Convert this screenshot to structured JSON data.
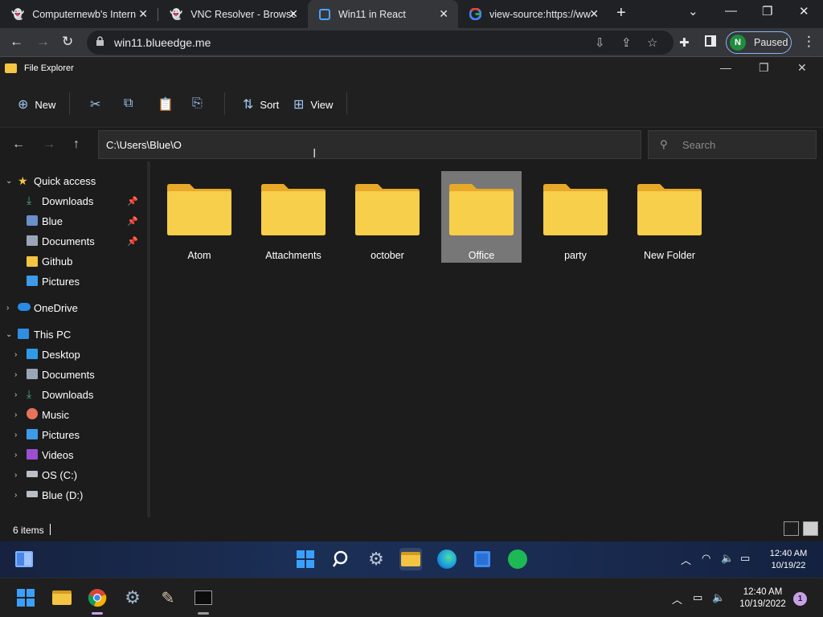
{
  "browser": {
    "tabs": [
      {
        "title": "Computernewb's Intern",
        "close": "✕"
      },
      {
        "title": "VNC Resolver - Browse",
        "close": "✕"
      },
      {
        "title": "Win11 in React",
        "close": "✕"
      },
      {
        "title": "view-source:https://ww",
        "close": "✕"
      }
    ],
    "active_tab": 2,
    "new_tab": "+",
    "url": "win11.blueedge.me",
    "profile_initial": "N",
    "profile_label": "Paused"
  },
  "explorer": {
    "title": "File Explorer",
    "commands": {
      "new_label": "New",
      "sort_label": "Sort",
      "view_label": "View"
    },
    "address": "C:\\Users\\Blue\\O",
    "search_placeholder": "Search",
    "sidebar": {
      "quick_access": "Quick access",
      "quick_items": [
        {
          "label": "Downloads",
          "pinned": true
        },
        {
          "label": "Blue",
          "pinned": true
        },
        {
          "label": "Documents",
          "pinned": true
        },
        {
          "label": "Github",
          "pinned": false
        },
        {
          "label": "Pictures",
          "pinned": false
        }
      ],
      "onedrive": "OneDrive",
      "this_pc": "This PC",
      "pc_items": [
        {
          "label": "Desktop"
        },
        {
          "label": "Documents"
        },
        {
          "label": "Downloads"
        },
        {
          "label": "Music"
        },
        {
          "label": "Pictures"
        },
        {
          "label": "Videos"
        },
        {
          "label": "OS (C:)"
        },
        {
          "label": "Blue (D:)"
        }
      ]
    },
    "folders": [
      {
        "name": "Atom",
        "selected": false
      },
      {
        "name": "Attachments",
        "selected": false
      },
      {
        "name": "october",
        "selected": false
      },
      {
        "name": "Office",
        "selected": true
      },
      {
        "name": "party",
        "selected": false
      },
      {
        "name": "New Folder",
        "selected": false
      }
    ],
    "status_count": "6 items"
  },
  "emulated_taskbar": {
    "time": "12:40 AM",
    "date": "10/19/22"
  },
  "host_taskbar": {
    "time": "12:40 AM",
    "date": "10/19/2022",
    "notifications": "1"
  },
  "colors": {
    "folder_yellow": "#f8c93a",
    "accent_blue": "#8ab4f8",
    "selection_gray": "#777777"
  }
}
